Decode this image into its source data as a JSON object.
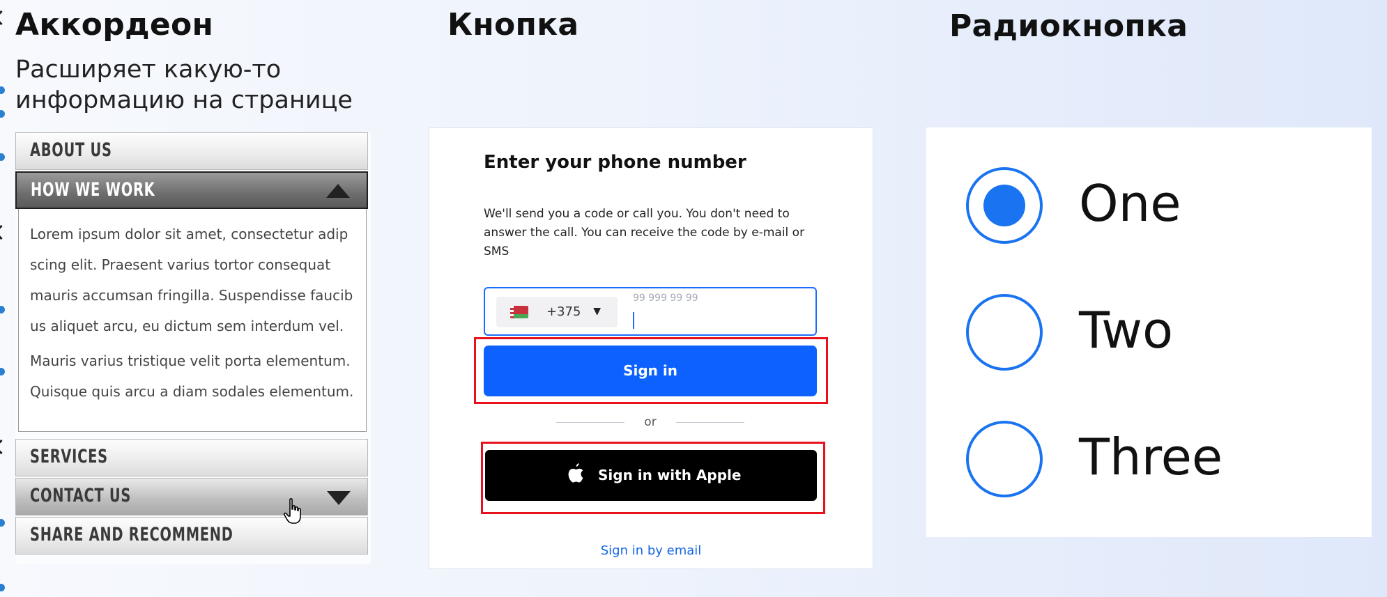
{
  "sections": {
    "accordion": {
      "title": "Аккордеон",
      "description": "Расширяет какую-то информацию на странице"
    },
    "button": {
      "title": "Кнопка"
    },
    "radio": {
      "title": "Радиокнопка"
    }
  },
  "accordion": {
    "items": [
      {
        "label": "ABOUT US",
        "state": "collapsed"
      },
      {
        "label": "HOW WE WORK",
        "state": "expanded"
      },
      {
        "label": "SERVICES",
        "state": "collapsed"
      },
      {
        "label": "CONTACT US",
        "state": "hover"
      },
      {
        "label": "SHARE AND RECOMMEND",
        "state": "collapsed"
      }
    ],
    "body_paragraphs": [
      "Lorem ipsum dolor sit amet, consectetur adip scing elit. Praesent varius tortor consequat mauris accumsan fringilla. Suspendisse faucib us aliquet arcu, eu dictum sem interdum vel.",
      "Mauris varius tristique velit porta elementum. Quisque quis arcu a diam sodales elementum."
    ],
    "expanded_icon": "triangle-up-icon",
    "collapsed_icon": "triangle-down-icon",
    "cursor_icon": "hand-pointer-icon"
  },
  "phone_form": {
    "heading": "Enter your phone number",
    "description": "We'll send you a code or call you. You don't need to answer the call. You can receive the code by e-mail or SMS",
    "country_code": "+375",
    "country_flag": "belarus-flag-icon",
    "phone_placeholder": "99 999 99 99",
    "phone_value": "",
    "sign_in_label": "Sign in",
    "divider_text": "or",
    "apple_label": "Sign in with Apple",
    "apple_icon": "apple-logo-icon",
    "email_link": "Sign in by email",
    "colors": {
      "primary": "#0d62ff",
      "highlight_frame": "#e8111e",
      "apple_button": "#000000"
    }
  },
  "radio_group": {
    "options": [
      {
        "label": "One",
        "selected": true
      },
      {
        "label": "Two",
        "selected": false
      },
      {
        "label": "Three",
        "selected": false
      }
    ],
    "accent": "#1a73f0"
  }
}
